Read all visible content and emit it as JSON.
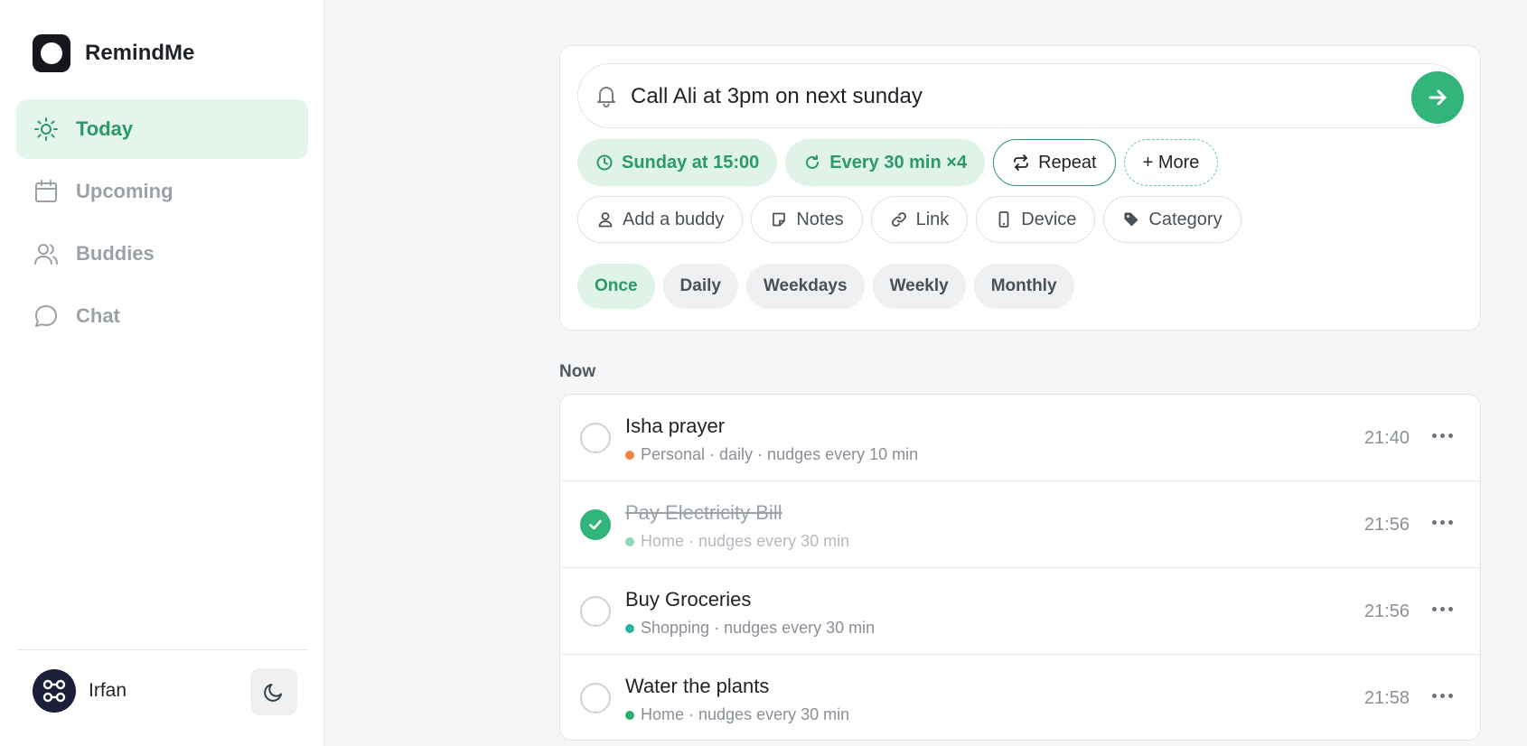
{
  "app": {
    "name": "RemindMe"
  },
  "sidebar": {
    "items": [
      {
        "label": "Today",
        "icon": "sun-icon",
        "active": true
      },
      {
        "label": "Upcoming",
        "icon": "calendar-icon",
        "active": false
      },
      {
        "label": "Buddies",
        "icon": "users-icon",
        "active": false
      },
      {
        "label": "Chat",
        "icon": "chat-bubble-icon",
        "active": false
      }
    ],
    "user": {
      "name": "Irfan"
    }
  },
  "composer": {
    "input_value": "Call Ali at 3pm on next sunday",
    "primary_chips": [
      {
        "label": "Sunday at 15:00",
        "icon": "clock-icon"
      },
      {
        "label": "Every 30 min ×4",
        "icon": "refresh-icon"
      },
      {
        "label": "Repeat",
        "icon": "repeat-icon"
      },
      {
        "label": "+ More"
      }
    ],
    "secondary_chips": [
      {
        "label": "Add a buddy",
        "icon": "user-icon"
      },
      {
        "label": "Notes",
        "icon": "note-icon"
      },
      {
        "label": "Link",
        "icon": "link-icon"
      },
      {
        "label": "Device",
        "icon": "phone-icon"
      },
      {
        "label": "Category",
        "icon": "tag-icon"
      }
    ],
    "frequencies": [
      {
        "label": "Once",
        "active": true
      },
      {
        "label": "Daily",
        "active": false
      },
      {
        "label": "Weekdays",
        "active": false
      },
      {
        "label": "Weekly",
        "active": false
      },
      {
        "label": "Monthly",
        "active": false
      }
    ]
  },
  "now": {
    "title": "Now",
    "items": [
      {
        "title": "Isha prayer",
        "meta": "Personal · daily · nudges every 10 min",
        "time": "21:40",
        "done": false,
        "dot_color": "#f0883e"
      },
      {
        "title": "Pay Electricity Bill",
        "meta": "Home · nudges every 30 min",
        "time": "21:56",
        "done": true,
        "dot_color": "#8fd9b6"
      },
      {
        "title": "Buy Groceries",
        "meta": "Shopping · nudges every 30 min",
        "time": "21:56",
        "done": false,
        "dot_color": "#2bb5a0"
      },
      {
        "title": "Water the plants",
        "meta": "Home · nudges every 30 min",
        "time": "21:58",
        "done": false,
        "dot_color": "#2aae6f"
      }
    ]
  },
  "colors": {
    "accent": "#31b57a",
    "accent_text": "#2b9a66",
    "accent_bg": "#dff3e8"
  }
}
